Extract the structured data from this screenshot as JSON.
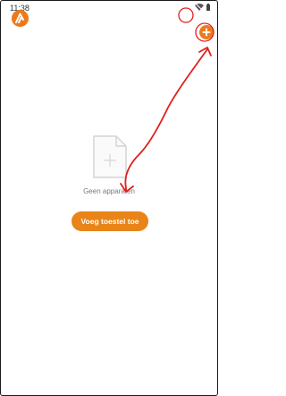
{
  "status_bar": {
    "time": "11:38",
    "icons": [
      "wifi-icon",
      "battery-icon"
    ]
  },
  "header": {
    "logo_icon": "app-logo-icon",
    "add_icon": "plus-icon"
  },
  "empty_state": {
    "icon": "empty-file-plus-icon",
    "message": "Geen apparaten",
    "add_button_label": "Voeg toestel toe"
  },
  "annotation": {
    "color": "#e0201c",
    "marks": [
      "red-circle-wifi",
      "red-circle-add",
      "red-arrow"
    ]
  },
  "colors": {
    "accent": "#e88418",
    "background": "#ffffff",
    "muted_text": "#7a7a7a"
  }
}
